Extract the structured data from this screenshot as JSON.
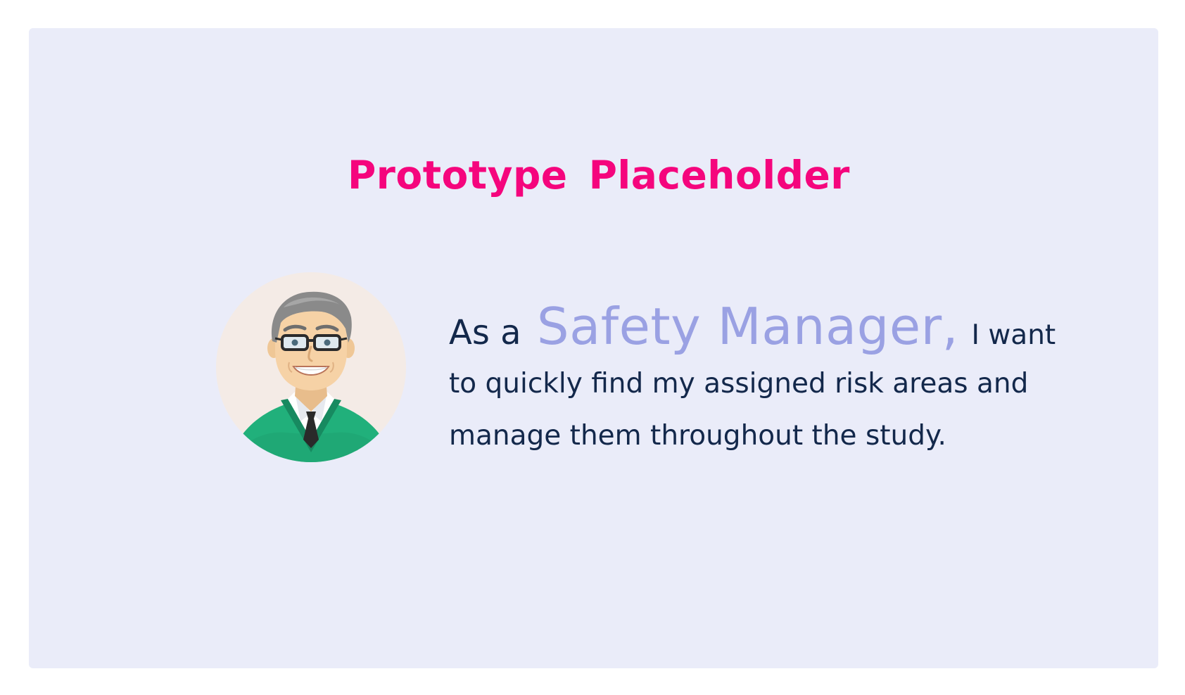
{
  "title": {
    "word1": "Prototype",
    "word2": "Placeholder"
  },
  "avatar": {
    "icon": "businessman-avatar-icon",
    "colors": {
      "background": "#f4ebe6",
      "sweater": "#21b07b",
      "hair": "#8a8a8a",
      "skin": "#f6d2a6"
    }
  },
  "story": {
    "prefix": "As a",
    "role": "Safety Manager,",
    "after_role": "I want",
    "line2": "to quickly find my assigned risk areas and",
    "line3": "manage them throughout the study."
  },
  "colors": {
    "card_bg": "#eaecf9",
    "title": "#f5057d",
    "role": "#9aa1e3",
    "text": "#13284b"
  }
}
